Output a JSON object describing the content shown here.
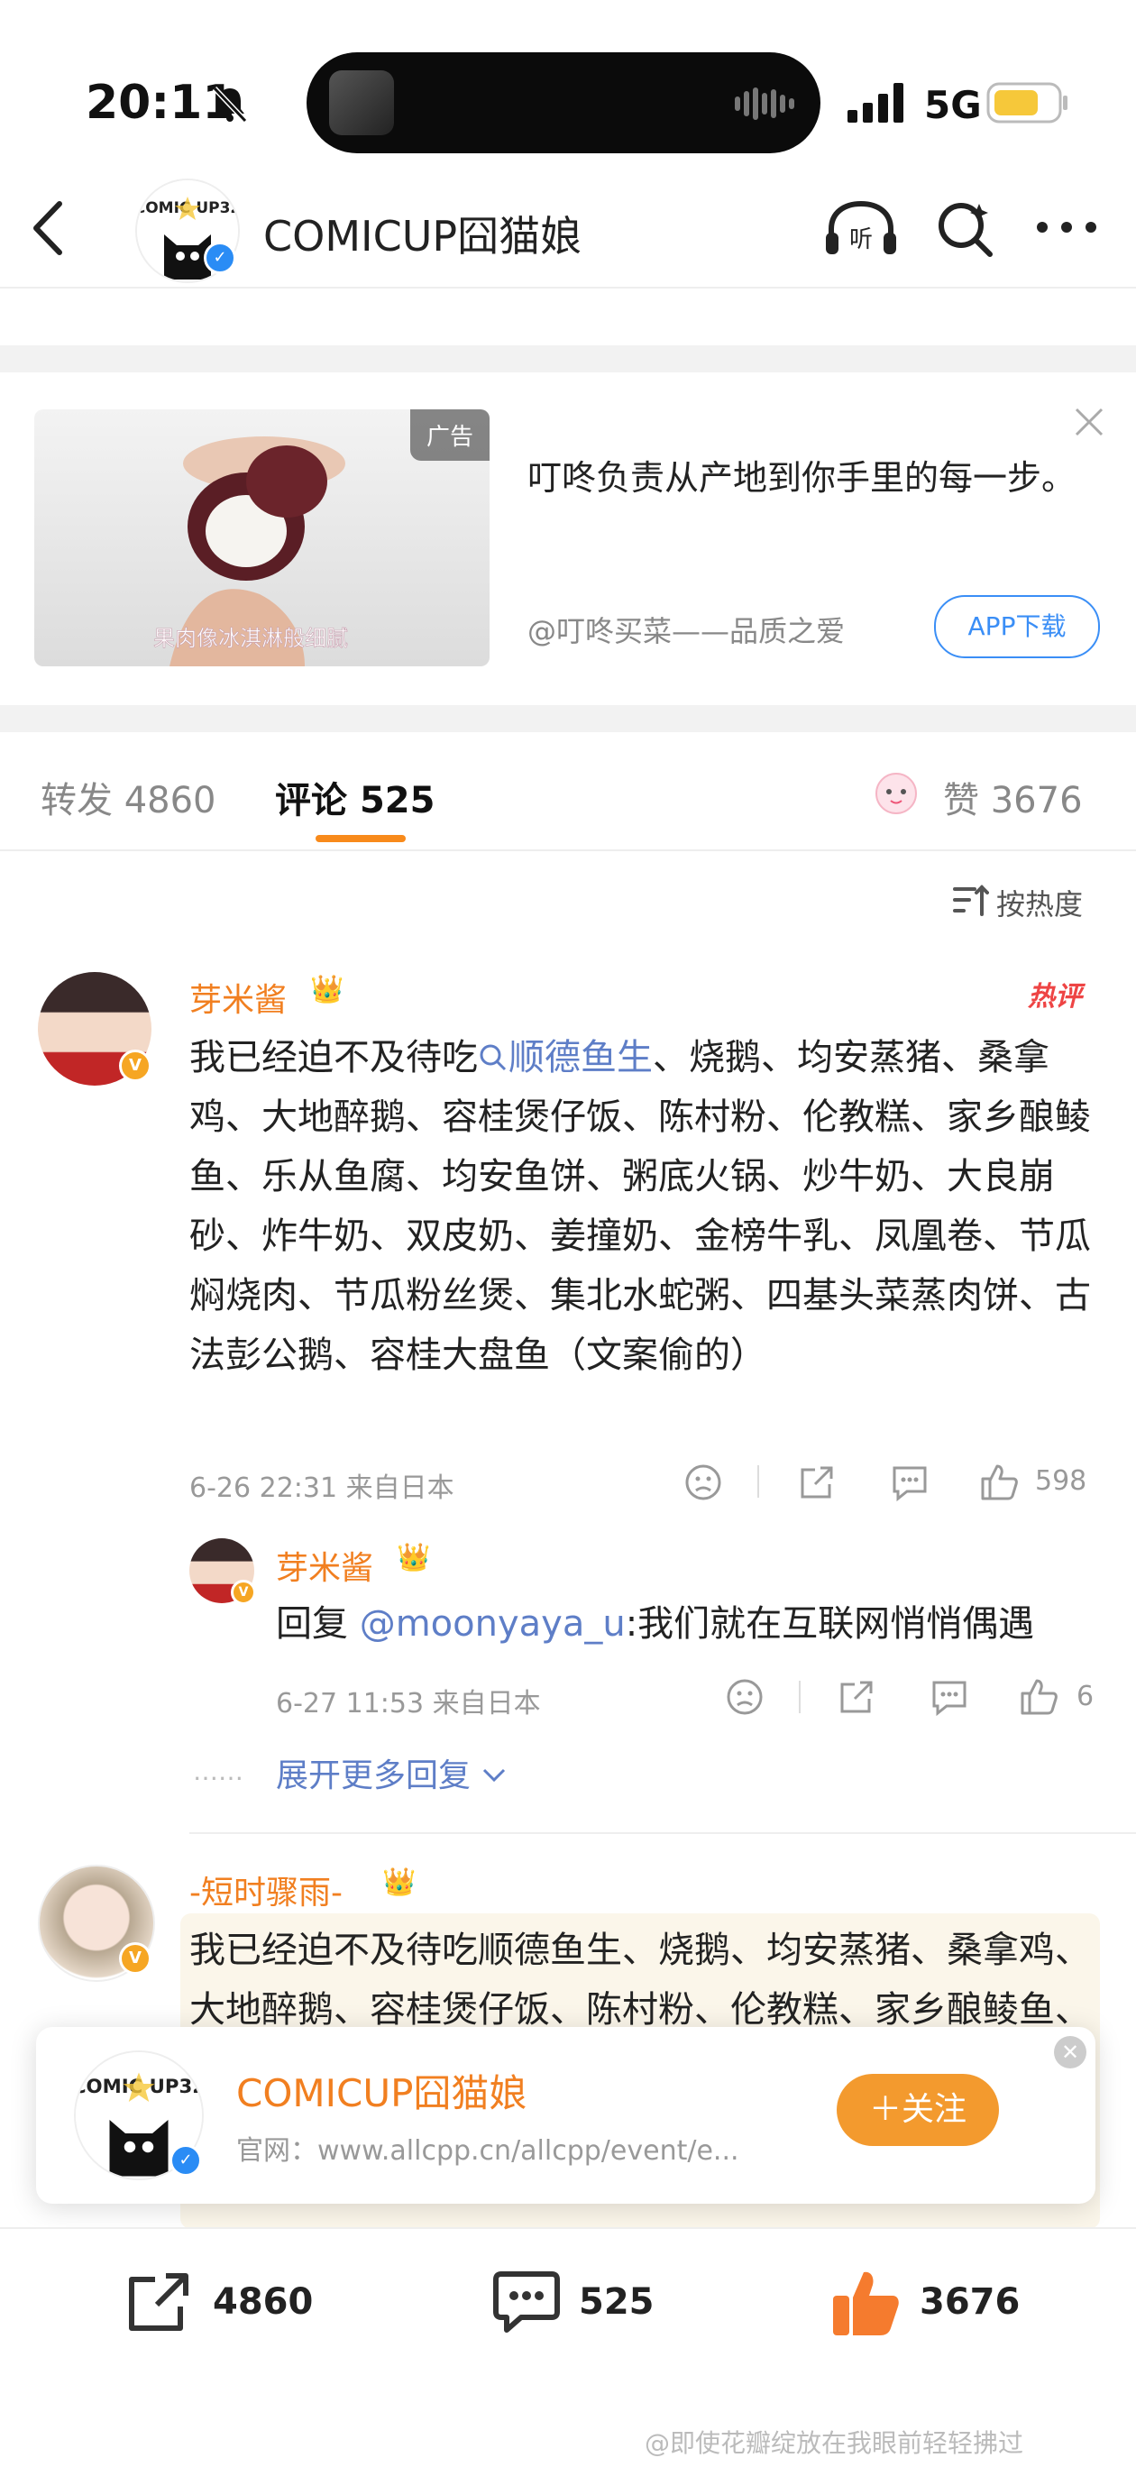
{
  "status_bar": {
    "time": "20:11",
    "network": "5G",
    "colors": {
      "battery": "#f6c83a"
    }
  },
  "header": {
    "account_name": "COMICUP囧猫娘",
    "logo_text": "COMIC UP32"
  },
  "ad": {
    "tag": "广告",
    "image_caption": "果肉像冰淇淋般细腻",
    "text": "叮咚负责从产地到你手里的每一步。",
    "source": "@叮咚买菜——品质之爱",
    "button": "APP下载"
  },
  "tabs": {
    "repost": "转发 4860",
    "comments_label": "评论",
    "comments_count": "525",
    "likes_label": "赞",
    "likes_count": "3676"
  },
  "sort": {
    "label": "按热度"
  },
  "comments": [
    {
      "user": "芽米酱",
      "hot_label": "热评",
      "text_prefix": "我已经迫不及待吃",
      "search_link": "顺德鱼生",
      "text_rest": "、烧鹅、均安蒸猪、桑拿鸡、大地醉鹅、容桂煲仔饭、陈村粉、伦教糕、家乡酿鲮鱼、乐从鱼腐、均安鱼饼、粥底火锅、炒牛奶、大良崩砂、炸牛奶、双皮奶、姜撞奶、金榜牛乳、凤凰卷、节瓜焖烧肉、节瓜粉丝煲、集北水蛇粥、四基头菜蒸肉饼、古法彭公鹅、容桂大盘鱼（文案偷的）",
      "time": "6-26 22:31",
      "source": "来自日本",
      "likes": "598",
      "reply": {
        "user": "芽米酱",
        "prefix": "回复 ",
        "mention": "@moonyaya_u",
        "text": ":我们就在互联网悄悄偶遇",
        "time": "6-27 11:53",
        "source": "来自日本",
        "likes": "6"
      },
      "expand": "展开更多回复"
    },
    {
      "user": "-短时骤雨-",
      "text": "我已经迫不及待吃顺德鱼生、烧鹅、均安蒸猪、桑拿鸡、大地醉鹅、容桂煲仔饭、陈村粉、伦教糕、家乡酿鲮鱼、乐从鱼腐、均安鱼饼、粥底火锅、炒牛奶、大良崩砂、炸牛奶、双皮奶、姜撞奶、金榜牛乳、凤凰卷、节瓜焖烧肉、节瓜粉丝煲、集北水"
    }
  ],
  "follow_card": {
    "name": "COMICUP囧猫娘",
    "site": "官网：www.allcpp.cn/allcpp/event/e...",
    "button": "＋关注"
  },
  "bottom_bar": {
    "reposts": "4860",
    "comments": "525",
    "likes": "3676"
  },
  "watermark": "@即使花瓣绽放在我眼前轻轻拂过"
}
